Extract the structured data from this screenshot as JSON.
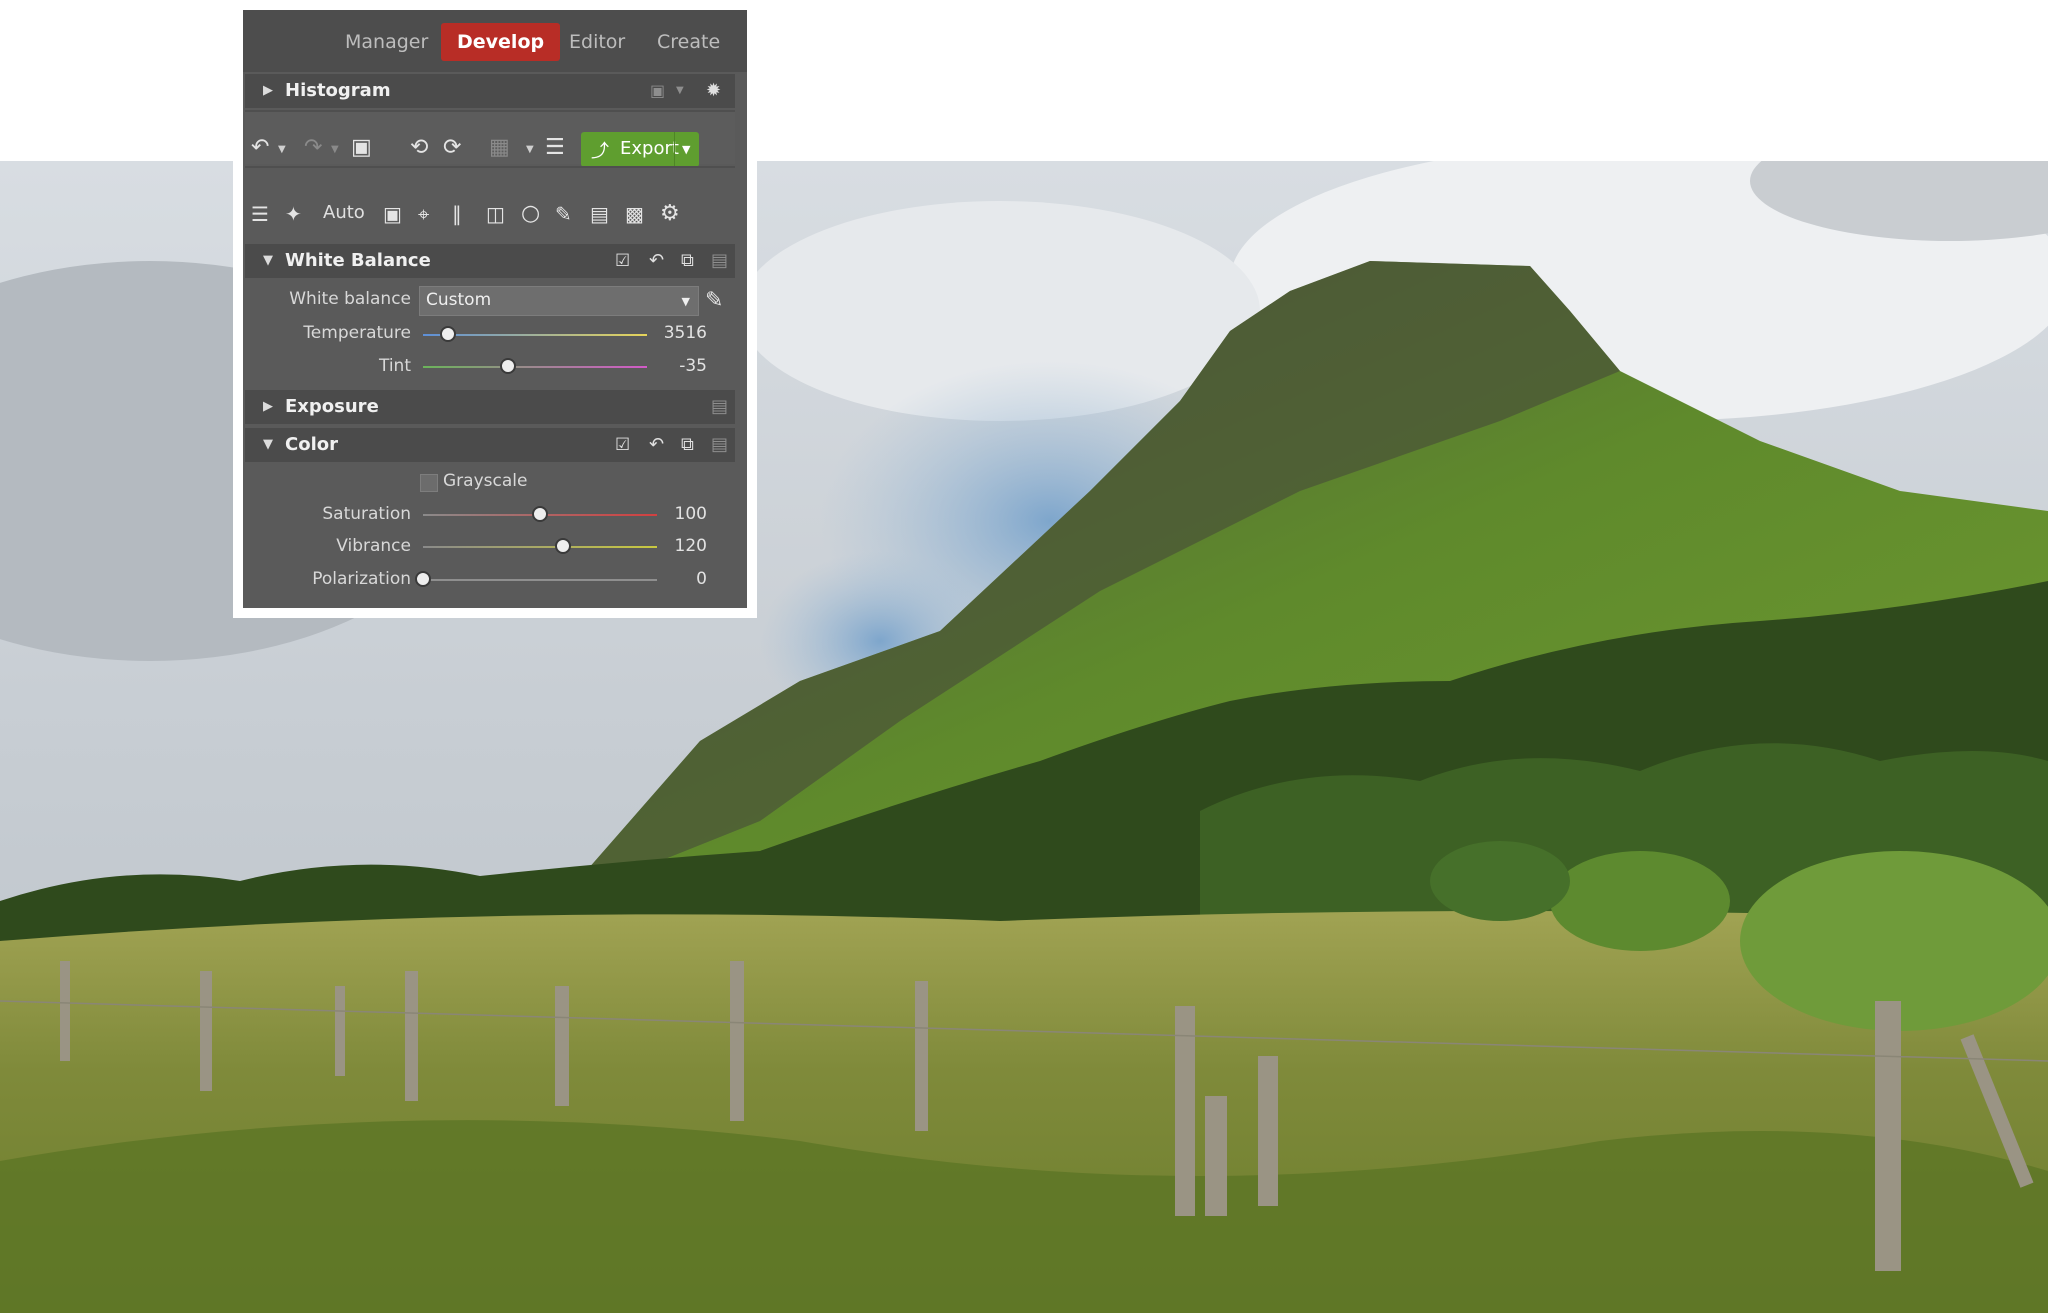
{
  "tabs": [
    {
      "label": "Manager",
      "active": false
    },
    {
      "label": "Develop",
      "active": true
    },
    {
      "label": "Editor",
      "active": false
    },
    {
      "label": "Create",
      "active": false
    }
  ],
  "histogram": {
    "title": "Histogram"
  },
  "toolbar": {
    "export_label": "Export",
    "icons": [
      "undo-icon",
      "redo-icon",
      "image-icon",
      "rotate-left-icon",
      "rotate-right-icon",
      "save-icon",
      "settings-icon",
      "export-icon"
    ]
  },
  "tools": {
    "auto_label": "Auto",
    "icons": [
      "sliders-icon",
      "wand-icon",
      "camera-icon",
      "crop-icon",
      "perspective-icon",
      "text-icon",
      "circle-icon",
      "brush-icon",
      "gradient-icon",
      "bandage-icon",
      "gear-icon"
    ]
  },
  "white_balance": {
    "title": "White Balance",
    "select_label": "White balance",
    "select_value": "Custom",
    "temperature": {
      "label": "Temperature",
      "value": "3516",
      "fraction": 0.11
    },
    "tint": {
      "label": "Tint",
      "value": "-35",
      "fraction": 0.38
    }
  },
  "exposure": {
    "title": "Exposure"
  },
  "color": {
    "title": "Color",
    "grayscale_label": "Grayscale",
    "saturation": {
      "label": "Saturation",
      "value": "100",
      "fraction": 0.5
    },
    "vibrance": {
      "label": "Vibrance",
      "value": "120",
      "fraction": 0.6
    },
    "polarization": {
      "label": "Polarization",
      "value": "0",
      "fraction": 0.0
    }
  },
  "colors": {
    "accent_develop": "#b82d26",
    "export_green": "#5f9e2f",
    "panel_bg": "#5a5a5a"
  }
}
